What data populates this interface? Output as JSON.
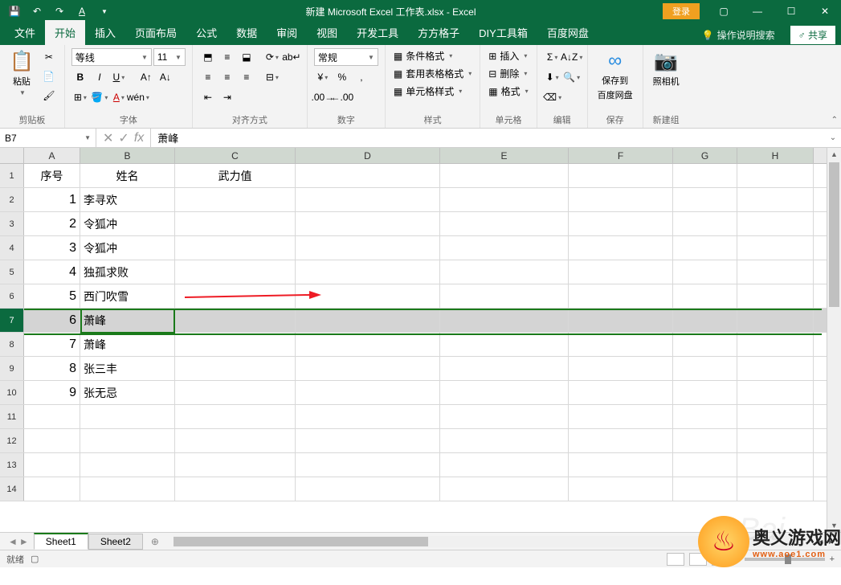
{
  "title": "新建 Microsoft Excel 工作表.xlsx - Excel",
  "login": "登录",
  "share": "共享",
  "help_search": "操作说明搜索",
  "tabs": [
    "文件",
    "开始",
    "插入",
    "页面布局",
    "公式",
    "数据",
    "审阅",
    "视图",
    "开发工具",
    "方方格子",
    "DIY工具箱",
    "百度网盘"
  ],
  "active_tab": 1,
  "ribbon": {
    "clipboard": {
      "paste": "粘贴",
      "label": "剪贴板"
    },
    "font": {
      "name": "等线",
      "size": "11",
      "label": "字体"
    },
    "align": {
      "label": "对齐方式"
    },
    "number": {
      "general": "常规",
      "label": "数字"
    },
    "styles": {
      "cond": "条件格式",
      "table": "套用表格格式",
      "cell": "单元格样式",
      "label": "样式"
    },
    "cells": {
      "insert": "插入",
      "delete": "删除",
      "format": "格式",
      "label": "单元格"
    },
    "editing": {
      "label": "编辑"
    },
    "save": {
      "saveto": "保存到",
      "baidu": "百度网盘",
      "label": "保存"
    },
    "camera": {
      "label": "照相机",
      "group": "新建组"
    }
  },
  "formula_bar": {
    "name_box": "B7",
    "value": "萧峰"
  },
  "columns": [
    "A",
    "B",
    "C",
    "D",
    "E",
    "F",
    "G",
    "H"
  ],
  "headers": {
    "A": "序号",
    "B": "姓名",
    "C": "武力值"
  },
  "data_rows": [
    {
      "n": "1",
      "name": "李寻欢"
    },
    {
      "n": "2",
      "name": "令狐冲"
    },
    {
      "n": "3",
      "name": "令狐冲"
    },
    {
      "n": "4",
      "name": "独孤求败"
    },
    {
      "n": "5",
      "name": "西门吹雪"
    },
    {
      "n": "6",
      "name": "萧峰"
    },
    {
      "n": "7",
      "name": "萧峰"
    },
    {
      "n": "8",
      "name": "张三丰"
    },
    {
      "n": "9",
      "name": "张无忌"
    }
  ],
  "selected_row": 7,
  "sheets": [
    "Sheet1",
    "Sheet2"
  ],
  "active_sheet": 0,
  "status": {
    "ready": "就绪"
  },
  "watermark": {
    "cn": "奥义游戏网",
    "en": "www.aoe1.com"
  }
}
